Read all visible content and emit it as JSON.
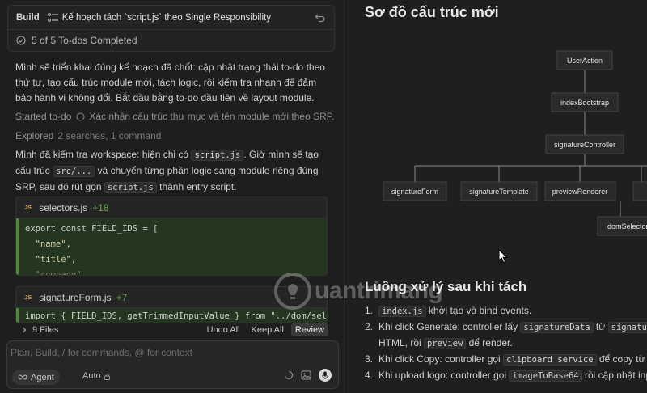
{
  "header": {
    "mode": "Build",
    "plan_title": "Kế hoạch tách `script.js` theo Single Responsibility",
    "todos_completed": "5 of 5 To-dos Completed"
  },
  "chat": {
    "para1": "Mình sẽ triển khai đúng kế hoạch đã chốt: cập nhật trạng thái to-do theo thứ tự, tạo cấu trúc module mới, tách logic, rồi kiểm tra nhanh để đảm bảo hành vi không đổi. Bắt đầu bằng to-do đầu tiên về layout module.",
    "started_label": "Started to-do",
    "started_task": "Xác nhận cấu trúc thư mục và tên module mới theo SRP.",
    "explored_label": "Explored",
    "explored_detail": "2 searches, 1 command",
    "p2_a": "Mình đã kiểm tra workspace: hiện chỉ có",
    "p2_code1": "script.js",
    "p2_b": ". Giờ mình sẽ tạo cấu trúc",
    "p2_code2": "src/...",
    "p2_c": "và chuyển từng phần logic sang module riêng đúng SRP, sau đó rút gọn",
    "p2_code3": "script.js",
    "p2_d": "thành entry script."
  },
  "files": [
    {
      "badge": "JS",
      "name": "selectors.js",
      "diff": "+18",
      "code": [
        "export const FIELD_IDS = [",
        "  \"name\",",
        "  \"title\",",
        "  \"company\","
      ]
    },
    {
      "badge": "JS",
      "name": "signatureForm.js",
      "diff": "+7",
      "code": [
        "import { FIELD_IDS, getTrimmedInputValue } from \"../dom/selectors.js\";"
      ]
    }
  ],
  "bottom_bar": {
    "files_label": "9 Files",
    "undo_all": "Undo All",
    "keep_all": "Keep All",
    "review": "Review"
  },
  "composer": {
    "placeholder": "Plan, Build, / for commands, @ for context",
    "agent": "Agent",
    "auto": "Auto"
  },
  "right": {
    "heading1": "Sơ đồ cấu trúc mới",
    "diagram_nodes": [
      "UserAction",
      "indexBootstrap",
      "signatureController",
      "signatureForm",
      "signatureTemplate",
      "previewRenderer",
      "domSelectors"
    ],
    "heading2": "Luồng xử lý sau khi tách",
    "steps": [
      {
        "num": "1.",
        "code1": "index.js",
        "text1": " khởi tạo và bind events."
      },
      {
        "num": "2.",
        "text0": "Khi click Generate: controller lấy ",
        "code1": "signatureData",
        "text1": " từ ",
        "code2": "signatureForm",
        "cont": "HTML, rồi ",
        "code3": "preview",
        "text3": " để render."
      },
      {
        "num": "3.",
        "text0": "Khi click Copy: controller gọi ",
        "code1": "clipboard service",
        "text1": " để copy từ output."
      },
      {
        "num": "4.",
        "text0": "Khi upload logo: controller gọi ",
        "code1": "imageToBase64",
        "text1": " rồi cập nhật input."
      }
    ]
  },
  "watermark": "uantrimang",
  "colors": {
    "background": "#1e1e1e",
    "diff_green": "#6aa84f",
    "code_added_bg": "#24361f"
  }
}
